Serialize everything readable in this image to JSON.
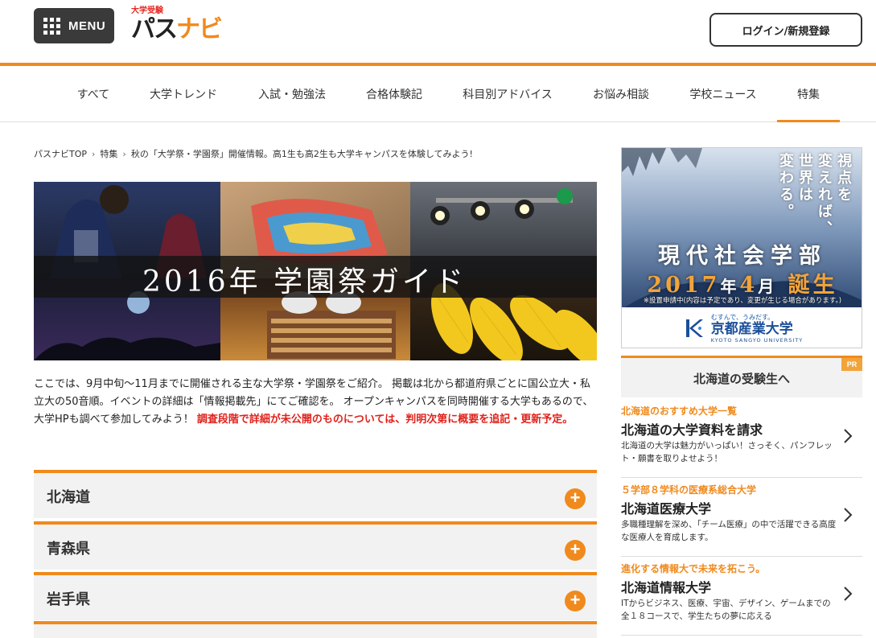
{
  "header": {
    "menu_label": "MENU",
    "logo_sub": "大学受験",
    "logo_main_a": "パス",
    "logo_main_b": "ナビ",
    "login_label": "ログイン/新規登録"
  },
  "nav": {
    "items": [
      {
        "label": "すべて"
      },
      {
        "label": "大学トレンド"
      },
      {
        "label": "入試・勉強法"
      },
      {
        "label": "合格体験記"
      },
      {
        "label": "科目別アドバイス"
      },
      {
        "label": "お悩み相談"
      },
      {
        "label": "学校ニュース"
      },
      {
        "label": "特集"
      }
    ],
    "active_index": 7
  },
  "breadcrumb": {
    "items": [
      "パスナビTOP",
      "特集",
      "秋の「大学祭・学園祭」開催情報。高1生も高2生も大学キャンパスを体験してみよう!"
    ]
  },
  "hero": {
    "title": "2016年 学園祭ガイド"
  },
  "intro": {
    "text": "ここでは、9月中旬～11月までに開催される主な大学祭・学園祭をご紹介。 掲載は北から都道府県ごとに国公立大・私立大の50音順。イベントの詳細は「情報掲載先」にてご確認を。 オープンキャンパスを同時開催する大学もあるので、大学HPも調べて参加してみよう！ ",
    "notice": "調査段階で詳細が未公開のものについては、判明次第に概要を追記・更新予定。"
  },
  "accordion": [
    {
      "label": "北海道"
    },
    {
      "label": "青森県"
    },
    {
      "label": "岩手県"
    }
  ],
  "ad": {
    "vertical_lines": [
      "視点を",
      "変えれば、",
      "世界は",
      "変わる。"
    ],
    "dept": "現代社会学部",
    "year_a": "2017",
    "year_w1": "年",
    "year_b": "4",
    "year_w2": "月",
    "year_c": "誕生",
    "note": "※設置申請中(内容は予定であり、変更が生じる場合があります。)",
    "logo_tag": "むすんで、うみだす。",
    "logo_name": "京都産業大学",
    "logo_en": "KYOTO SANGYO UNIVERSITY"
  },
  "sidebar": {
    "title": "北海道の受験生へ",
    "badge": "PR",
    "items": [
      {
        "catch": "北海道のおすすめ大学一覧",
        "name": "北海道の大学資料を請求",
        "desc": "北海道の大学は魅力がいっぱい！さっそく、パンフレット・願書を取りよせよう！"
      },
      {
        "catch": "５学部８学科の医療系総合大学",
        "name": "北海道医療大学",
        "desc": "多職種理解を深め、「チーム医療」の中で活躍できる高度な医療人を育成します。"
      },
      {
        "catch": "進化する情報大で未来を拓こう。",
        "name": "北海道情報大学",
        "desc": "ITからビジネス、医療、宇宙、デザイン、ゲームまでの全１８コースで、学生たちの夢に応える"
      }
    ]
  },
  "colors": {
    "accent": "#f08a1d",
    "dark": "#3a3a3a",
    "notice_red": "#e0221b"
  }
}
